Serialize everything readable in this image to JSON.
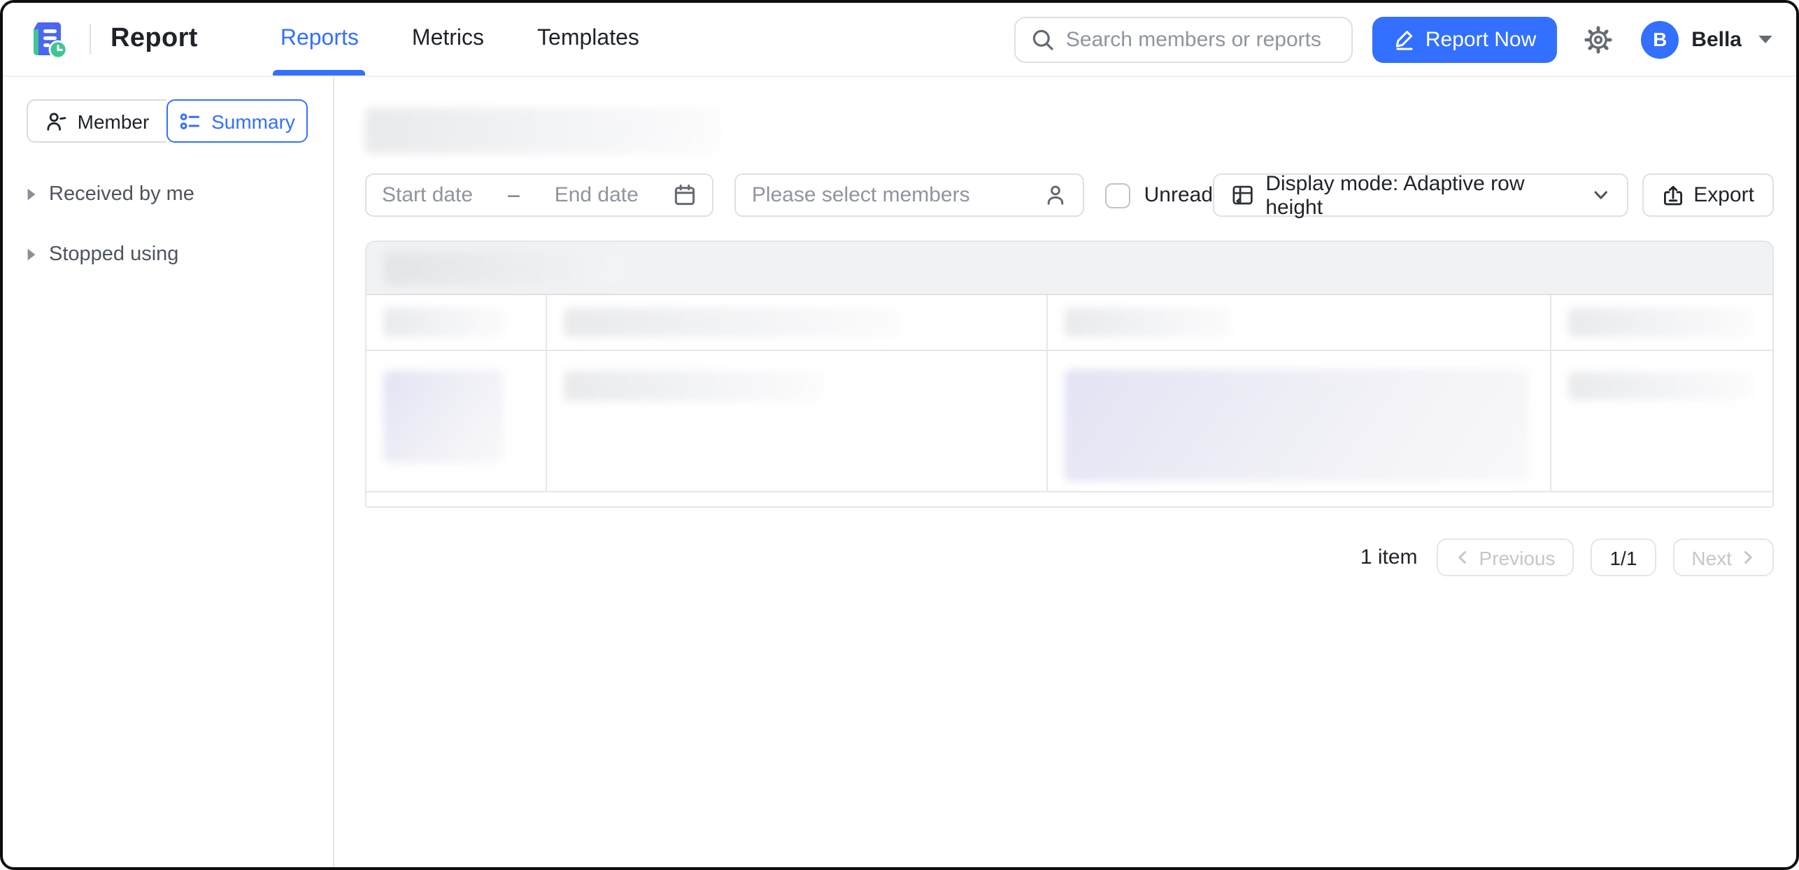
{
  "header": {
    "app_title": "Report",
    "tabs": [
      {
        "label": "Reports",
        "active": true
      },
      {
        "label": "Metrics",
        "active": false
      },
      {
        "label": "Templates",
        "active": false
      }
    ],
    "search_placeholder": "Search members or reports",
    "report_now_label": "Report Now",
    "user": {
      "initial": "B",
      "name": "Bella"
    }
  },
  "sidebar": {
    "view_toggle": [
      {
        "label": "Member",
        "active": false
      },
      {
        "label": "Summary",
        "active": true
      }
    ],
    "items": [
      {
        "label": "Received by me"
      },
      {
        "label": "Stopped using"
      }
    ]
  },
  "filters": {
    "date_start_placeholder": "Start date",
    "date_separator": "–",
    "date_end_placeholder": "End date",
    "members_placeholder": "Please select members",
    "unread_label": "Unread",
    "unread_checked": false,
    "display_mode_label": "Display mode: Adaptive row height",
    "export_label": "Export"
  },
  "pagination": {
    "total_label": "1 item",
    "previous_label": "Previous",
    "page_indicator": "1/1",
    "next_label": "Next"
  },
  "icons": [
    "app-logo-icon",
    "search-icon",
    "pencil-icon",
    "gear-icon",
    "caret-down-icon",
    "member-person-icon",
    "summary-list-icon",
    "tree-caret-icon",
    "calendar-icon",
    "person-icon",
    "display-grid-icon",
    "chevron-down-icon",
    "export-icon",
    "chevron-left-icon",
    "chevron-right-icon"
  ],
  "colors": {
    "accent": "#3370ff",
    "logo_green": "#3fc693",
    "text": "#1f2329",
    "muted_text": "#8f959e",
    "border": "#dee0e3",
    "table_band_bg": "#f1f2f4"
  }
}
